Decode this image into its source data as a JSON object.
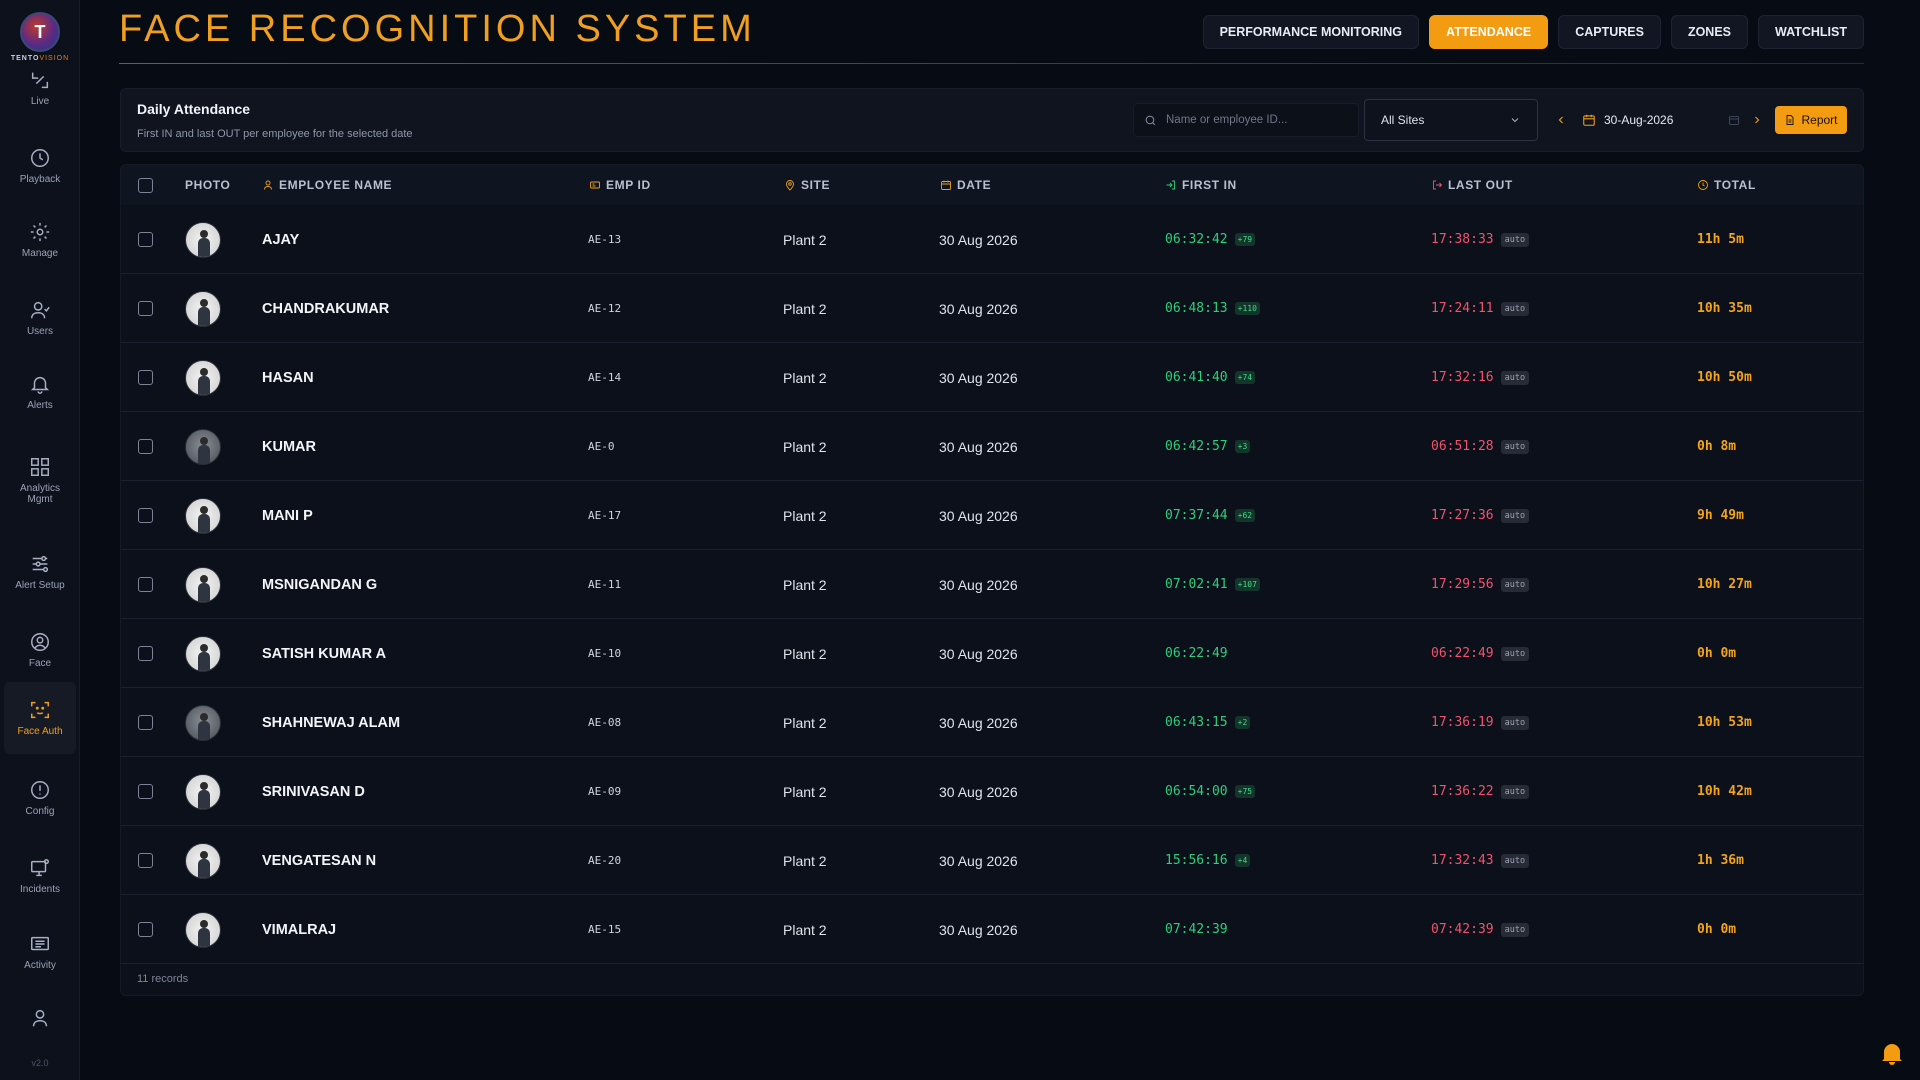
{
  "app": {
    "title": "FACE RECOGNITION SYSTEM",
    "logo_text_a": "TENTO",
    "logo_text_b": "VISION",
    "logo_letter": "T",
    "version": "v2.0"
  },
  "sidebar": {
    "items": [
      {
        "label": "Live",
        "icon": "live-icon"
      },
      {
        "label": "Playback",
        "icon": "clock-icon"
      },
      {
        "label": "Manage",
        "icon": "gear-icon"
      },
      {
        "label": "Users",
        "icon": "users-icon"
      },
      {
        "label": "Alerts",
        "icon": "bell-icon"
      },
      {
        "label": "Analytics Mgmt",
        "icon": "grid-icon"
      },
      {
        "label": "Alert Setup",
        "icon": "sliders-icon"
      },
      {
        "label": "Face",
        "icon": "face-icon"
      },
      {
        "label": "Face Auth",
        "icon": "face-scan-icon",
        "active": true
      },
      {
        "label": "Config",
        "icon": "alert-circle-icon"
      },
      {
        "label": "Incidents",
        "icon": "monitor-icon"
      },
      {
        "label": "Activity",
        "icon": "activity-icon"
      },
      {
        "label": "",
        "icon": "user-icon"
      }
    ]
  },
  "topnav": {
    "tabs": [
      {
        "label": "PERFORMANCE MONITORING",
        "active": false
      },
      {
        "label": "ATTENDANCE",
        "active": true
      },
      {
        "label": "CAPTURES",
        "active": false
      },
      {
        "label": "ZONES",
        "active": false
      },
      {
        "label": "WATCHLIST",
        "active": false
      }
    ]
  },
  "filters": {
    "title": "Daily Attendance",
    "subtitle": "First IN and last OUT per employee for the selected date",
    "search_placeholder": "Name or employee ID...",
    "site_value": "All Sites",
    "date_value": "30-Aug-2026",
    "report_label": "Report"
  },
  "table": {
    "columns": {
      "photo": "PHOTO",
      "name": "EMPLOYEE NAME",
      "emp_id": "EMP ID",
      "site": "SITE",
      "date": "DATE",
      "first_in": "FIRST IN",
      "last_out": "LAST OUT",
      "total": "TOTAL"
    },
    "rows": [
      {
        "name": "AJAY",
        "emp_id": "AE-13",
        "site": "Plant 2",
        "date": "30 Aug 2026",
        "first_in": "06:32:42",
        "in_badge": "+79",
        "last_out": "17:38:33",
        "out_badge": "auto",
        "total": "11h 5m",
        "photo": "light"
      },
      {
        "name": "CHANDRAKUMAR",
        "emp_id": "AE-12",
        "site": "Plant 2",
        "date": "30 Aug 2026",
        "first_in": "06:48:13",
        "in_badge": "+110",
        "last_out": "17:24:11",
        "out_badge": "auto",
        "total": "10h 35m",
        "photo": "light"
      },
      {
        "name": "HASAN",
        "emp_id": "AE-14",
        "site": "Plant 2",
        "date": "30 Aug 2026",
        "first_in": "06:41:40",
        "in_badge": "+74",
        "last_out": "17:32:16",
        "out_badge": "auto",
        "total": "10h 50m",
        "photo": "light"
      },
      {
        "name": "KUMAR",
        "emp_id": "AE-0",
        "site": "Plant 2",
        "date": "30 Aug 2026",
        "first_in": "06:42:57",
        "in_badge": "+3",
        "last_out": "06:51:28",
        "out_badge": "auto",
        "total": "0h 8m",
        "photo": "dark"
      },
      {
        "name": "MANI P",
        "emp_id": "AE-17",
        "site": "Plant 2",
        "date": "30 Aug 2026",
        "first_in": "07:37:44",
        "in_badge": "+62",
        "last_out": "17:27:36",
        "out_badge": "auto",
        "total": "9h 49m",
        "photo": "light"
      },
      {
        "name": "MSNIGANDAN G",
        "emp_id": "AE-11",
        "site": "Plant 2",
        "date": "30 Aug 2026",
        "first_in": "07:02:41",
        "in_badge": "+107",
        "last_out": "17:29:56",
        "out_badge": "auto",
        "total": "10h 27m",
        "photo": "light"
      },
      {
        "name": "SATISH KUMAR A",
        "emp_id": "AE-10",
        "site": "Plant 2",
        "date": "30 Aug 2026",
        "first_in": "06:22:49",
        "in_badge": "",
        "last_out": "06:22:49",
        "out_badge": "auto",
        "total": "0h 0m",
        "photo": "light"
      },
      {
        "name": "SHAHNEWAJ ALAM",
        "emp_id": "AE-08",
        "site": "Plant 2",
        "date": "30 Aug 2026",
        "first_in": "06:43:15",
        "in_badge": "+2",
        "last_out": "17:36:19",
        "out_badge": "auto",
        "total": "10h 53m",
        "photo": "dark"
      },
      {
        "name": "SRINIVASAN D",
        "emp_id": "AE-09",
        "site": "Plant 2",
        "date": "30 Aug 2026",
        "first_in": "06:54:00",
        "in_badge": "+75",
        "last_out": "17:36:22",
        "out_badge": "auto",
        "total": "10h 42m",
        "photo": "light"
      },
      {
        "name": "VENGATESAN N",
        "emp_id": "AE-20",
        "site": "Plant 2",
        "date": "30 Aug 2026",
        "first_in": "15:56:16",
        "in_badge": "+4",
        "last_out": "17:32:43",
        "out_badge": "auto",
        "total": "1h 36m",
        "photo": "light"
      },
      {
        "name": "VIMALRAJ",
        "emp_id": "AE-15",
        "site": "Plant 2",
        "date": "30 Aug 2026",
        "first_in": "07:42:39",
        "in_badge": "",
        "last_out": "07:42:39",
        "out_badge": "auto",
        "total": "0h 0m",
        "photo": "light"
      }
    ],
    "records_label": "11 records"
  },
  "colors": {
    "accent": "#f39c12",
    "in": "#2fcf7a",
    "out": "#f2536a",
    "total": "#f3a41c"
  }
}
